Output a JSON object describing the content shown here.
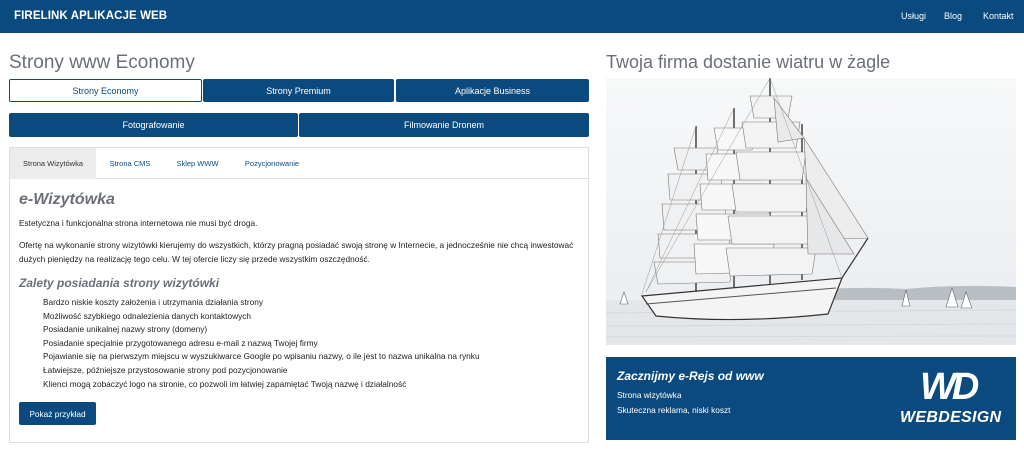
{
  "header": {
    "brand": "FIRELINK APLIKACJE WEB",
    "nav": [
      "Usługi",
      "Blog",
      "Kontakt"
    ]
  },
  "left": {
    "title": "Strony www Economy",
    "buttons_row1": [
      "Strony Economy",
      "Strony Premium",
      "Aplikacje Business"
    ],
    "buttons_row2": [
      "Fotografowanie",
      "Filmowanie Dronem"
    ],
    "active_button": "Strony Economy",
    "tabs": [
      "Strona Wizytówka",
      "Strona CMS",
      "Sklep WWW",
      "Pozycjonowanie"
    ],
    "active_tab": "Strona Wizytówka",
    "panel": {
      "title": "e-Wizytówka",
      "para1": "Estetyczna i funkcjonalna strona internetowa nie musi być droga.",
      "para2": "Ofertę na wykonanie strony wizytówki kierujemy do wszystkich, którzy pragną posiadać swoją stronę w Internecie, a jednocześnie nie chcą inwestować dużych pieniędzy na realizację tego celu. W tej ofercie liczy się przede wszystkim oszczędność.",
      "subtitle": "Zalety posiadania strony wizytówki",
      "advantages": [
        "Bardzo niskie koszty założenia i utrzymania działania strony",
        "Możliwość szybkiego odnalezienia danych kontaktowych",
        "Posiadanie unikalnej nazwy strony (domeny)",
        "Posiadanie specjalnie przygotowanego adresu e-mail z nazwą Twojej firmy",
        "Pojawianie się na pierwszym miejscu w wyszukiwarce Google po wpisaniu nazwy, o ile jest to nazwa unikalna na rynku",
        "Łatwiejsze, późniejsze przystosowanie strony pod pozycjonowanie",
        "Klienci mogą zobaczyć logo na stronie, co pozwoli im łatwiej zapamiętać Twoją nazwę i działalność"
      ],
      "example_button": "Pokaż przykład"
    }
  },
  "right": {
    "title": "Twoja firma dostanie wiatru w żagle",
    "photo_icon": "sailing-ship-photo",
    "promo": {
      "title": "Zacznijmy e-Rejs od www",
      "line1": "Strona wizytówka",
      "line2": "Skuteczna reklama, niski koszt",
      "logo_mark": "WD",
      "logo_text": "WEBDESIGN"
    }
  },
  "colors": {
    "primary": "#0b4a7e",
    "heading": "#6a6f79",
    "tab_active_bg": "#ececec"
  }
}
